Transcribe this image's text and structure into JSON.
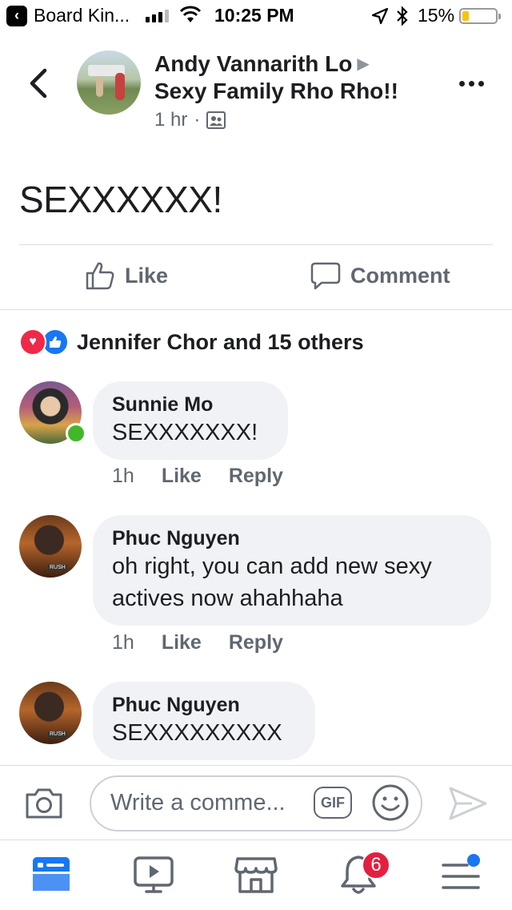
{
  "status_bar": {
    "back_app": "Board Kin...",
    "time": "10:25 PM",
    "battery": "15%"
  },
  "post": {
    "author": "Andy Vannarith Lo",
    "group": "Sexy Family Rho Rho!!",
    "time": "1 hr",
    "separator": "·",
    "text": "SEXXXXXX!"
  },
  "actions": {
    "like": "Like",
    "comment": "Comment"
  },
  "reactions": {
    "summary": "Jennifer Chor and 15 others"
  },
  "comments": [
    {
      "name": "Sunnie Mo",
      "text": "SEXXXXXXX!",
      "time": "1h",
      "like": "Like",
      "reply": "Reply"
    },
    {
      "name": "Phuc Nguyen",
      "text_line1": "oh right, you can add new sexy",
      "text_line2": "actives now ahahhaha",
      "time": "1h",
      "like": "Like",
      "reply": "Reply"
    },
    {
      "name": "Phuc Nguyen",
      "text": "SEXXXXXXXXX"
    }
  ],
  "composer": {
    "placeholder": "Write a comme...",
    "gif": "GIF"
  },
  "tab_bar": {
    "notifications_badge": "6"
  },
  "colors": {
    "accent": "#1877f2",
    "badge": "#e41e3f",
    "online": "#42b72a",
    "bubble": "#f0f2f5"
  }
}
